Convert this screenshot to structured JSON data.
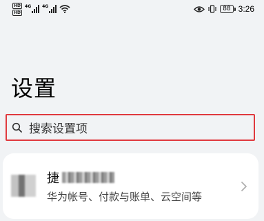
{
  "status_bar": {
    "sim1": "HD",
    "sim2": "HD",
    "net1": "4G",
    "net2": "4G",
    "battery": "88",
    "time": "3:26"
  },
  "page": {
    "title": "设置"
  },
  "search": {
    "placeholder": "搜索设置项"
  },
  "account": {
    "name_visible": "捷",
    "subtitle": "华为帐号、付款与账单、云空间等"
  }
}
